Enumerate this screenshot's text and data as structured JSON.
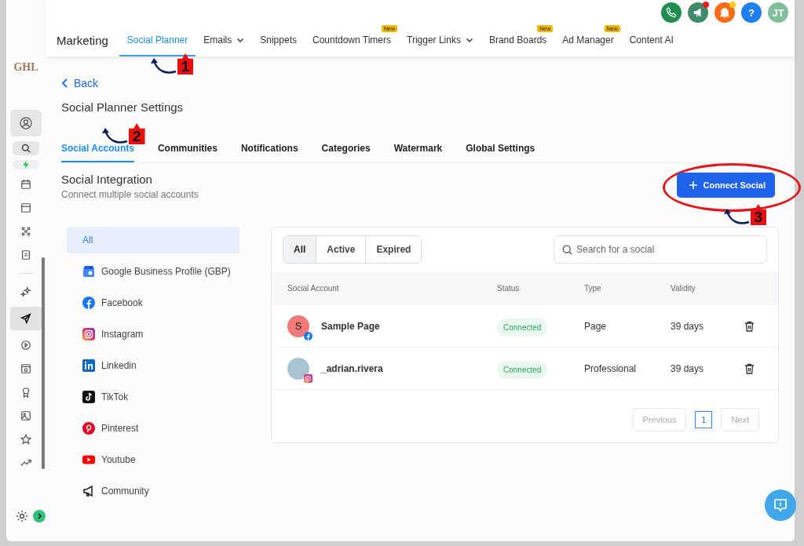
{
  "app": {
    "logo": "GHL"
  },
  "sidebar": {
    "groups": [
      [
        {
          "kind": "calendar",
          "selected": false
        },
        {
          "kind": "inbox",
          "selected": false
        },
        {
          "kind": "grid",
          "selected": false
        },
        {
          "kind": "document",
          "selected": false
        }
      ],
      [
        {
          "kind": "sparkle",
          "selected": false
        },
        {
          "kind": "send",
          "selected": true
        },
        {
          "kind": "play",
          "selected": false
        },
        {
          "kind": "window",
          "selected": false
        },
        {
          "kind": "award",
          "selected": false
        },
        {
          "kind": "image",
          "selected": false
        },
        {
          "kind": "star",
          "selected": false
        },
        {
          "kind": "trend",
          "selected": false
        }
      ]
    ]
  },
  "nav": {
    "title": "Marketing",
    "items": [
      {
        "label": "Social Planner",
        "selected": true,
        "dropdown": false
      },
      {
        "label": "Emails",
        "selected": false,
        "dropdown": true
      },
      {
        "label": "Snippets",
        "selected": false,
        "dropdown": false
      },
      {
        "label": "Countdown Timers",
        "selected": false,
        "dropdown": false,
        "badge": "New"
      },
      {
        "label": "Trigger Links",
        "selected": false,
        "dropdown": true
      },
      {
        "label": "Brand Boards",
        "selected": false,
        "dropdown": false,
        "badge": "New"
      },
      {
        "label": "Ad Manager",
        "selected": false,
        "dropdown": false,
        "badge": "New"
      },
      {
        "label": "Content AI",
        "selected": false,
        "dropdown": false
      }
    ]
  },
  "header_actions": [
    {
      "kind": "phone",
      "color": "#1e8e4e",
      "dot": false
    },
    {
      "kind": "megaphone",
      "color": "#3f8a6a",
      "dot": true
    },
    {
      "kind": "bell",
      "color": "#fb6a16",
      "dot": true
    },
    {
      "kind": "help",
      "color": "#1f7ef0",
      "text": "?",
      "dot": false
    },
    {
      "kind": "avatar",
      "color": "#7fbf9a",
      "text": "JT",
      "dot": false
    }
  ],
  "back": "Back",
  "page_title": "Social Planner Settings",
  "tabs": [
    {
      "label": "Social Accounts",
      "selected": true
    },
    {
      "label": "Communities",
      "selected": false
    },
    {
      "label": "Notifications",
      "selected": false
    },
    {
      "label": "Categories",
      "selected": false
    },
    {
      "label": "Watermark",
      "selected": false
    },
    {
      "label": "Global Settings",
      "selected": false
    }
  ],
  "section": {
    "title": "Social Integration",
    "subtitle": "Connect multiple social accounts"
  },
  "connect_button": "Connect Social",
  "platforms": [
    {
      "label": "All",
      "kind": "all",
      "selected": true
    },
    {
      "label": "Google Business Profile (GBP)",
      "kind": "gbp",
      "selected": false
    },
    {
      "label": "Facebook",
      "kind": "facebook",
      "selected": false
    },
    {
      "label": "Instagram",
      "kind": "instagram",
      "selected": false
    },
    {
      "label": "Linkedin",
      "kind": "linkedin",
      "selected": false
    },
    {
      "label": "TikTok",
      "kind": "tiktok",
      "selected": false
    },
    {
      "label": "Pinterest",
      "kind": "pinterest",
      "selected": false
    },
    {
      "label": "Youtube",
      "kind": "youtube",
      "selected": false
    },
    {
      "label": "Community",
      "kind": "community",
      "selected": false
    }
  ],
  "filters": [
    {
      "label": "All",
      "selected": true
    },
    {
      "label": "Active",
      "selected": false
    },
    {
      "label": "Expired",
      "selected": false
    }
  ],
  "search": {
    "placeholder": "Search for a social"
  },
  "table": {
    "columns": [
      "Social Account",
      "Status",
      "Type",
      "Validity"
    ],
    "rows": [
      {
        "avatar": {
          "kind": "letter",
          "initial": "S"
        },
        "network": {
          "kind": "facebook"
        },
        "name": "Sample Page",
        "status": "Connected",
        "type": "Page",
        "validity": "39 days"
      },
      {
        "avatar": {
          "kind": "photo"
        },
        "network": {
          "kind": "instagram"
        },
        "name": "_adrian.rivera",
        "status": "Connected",
        "type": "Professional",
        "validity": "39 days"
      }
    ]
  },
  "pagination": {
    "previous": "Previous",
    "next": "Next",
    "pages": [
      {
        "label": "1",
        "selected": true
      }
    ],
    "previous_disabled": true,
    "next_disabled": true
  },
  "annotations": {
    "nav": "1",
    "tabs": "2",
    "connect": "3"
  }
}
